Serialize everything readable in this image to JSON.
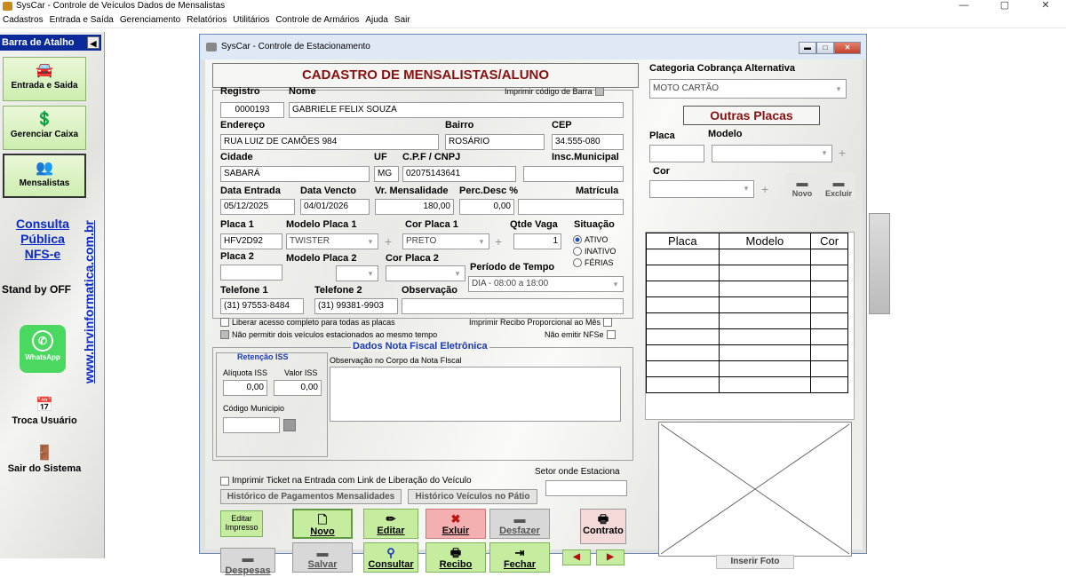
{
  "titlebar": {
    "title": "SysCar - Controle de Veículos  Dados de Mensalistas"
  },
  "winctl": {
    "min": "—",
    "max": "▢",
    "close": "✕"
  },
  "menu": [
    "Cadastros",
    "Entrada e Saída",
    "Gerenciamento",
    "Relatórios",
    "Utilitários",
    "Controle de Armários",
    "Ajuda",
    "Sair"
  ],
  "sidebar": {
    "header": "Barra de Atalho",
    "buttons": [
      {
        "label": "Entrada e Saida",
        "icon": "car-icon"
      },
      {
        "label": "Gerenciar Caixa",
        "icon": "money-icon"
      },
      {
        "label": "Mensalistas",
        "icon": "users-icon"
      }
    ],
    "nfse": "Consulta Pública NFS-e",
    "standby": "Stand by OFF",
    "whatsapp": "WhatsApp",
    "troca": "Troca Usuário",
    "sair": "Sair do Sistema",
    "url": "www.hrvinformatica.com.br"
  },
  "window": {
    "title": "SysCar - Controle de Estacionamento"
  },
  "form": {
    "heading": "CADASTRO DE MENSALISTAS/ALUNO",
    "labels": {
      "registro": "Registro",
      "nome": "Nome",
      "imprimir_codigo": "Imprimir código de Barra",
      "endereco": "Endereço",
      "bairro": "Bairro",
      "cep": "CEP",
      "cidade": "Cidade",
      "uf": "UF",
      "cpf": "C.P.F / CNPJ",
      "insc": "Insc.Municipal",
      "data_entrada": "Data Entrada",
      "data_vencto": "Data Vencto",
      "vr_mensalidade": "Vr. Mensalidade",
      "perc_desc": "Perc.Desc %",
      "matricula": "Matrícula",
      "placa1": "Placa 1",
      "modelo1": "Modelo Placa 1",
      "cor1": "Cor Placa 1",
      "qtde_vaga": "Qtde Vaga",
      "situacao": "Situação",
      "placa2": "Placa 2",
      "modelo2": "Modelo Placa 2",
      "cor2": "Cor Placa 2",
      "periodo": "Período de Tempo",
      "tel1": "Telefone 1",
      "tel2": "Telefone 2",
      "obs": "Observação"
    },
    "values": {
      "registro": "0000193",
      "nome": "GABRIELE FELIX SOUZA",
      "endereco": "RUA LUIZ DE CAMÕES 984",
      "bairro": "ROSÁRIO",
      "cep": "34.555-080",
      "cidade": "SABARÁ",
      "uf": "MG",
      "cpf": "02075143641",
      "insc": "",
      "data_entrada": "05/12/2025",
      "data_vencto": "04/01/2026",
      "vr_mensalidade": "180,00",
      "perc_desc": "0,00",
      "matricula": "",
      "placa1": "HFV2D92",
      "modelo1": "TWISTER",
      "cor1": "PRETO",
      "qtde_vaga": "1",
      "placa2": "",
      "modelo2": "",
      "cor2": "",
      "periodo": "DIA - 08:00 a 18:00",
      "tel1": "(31) 97553-8484",
      "tel2": "(31) 99381-9903",
      "obs": ""
    },
    "situacao_options": [
      {
        "label": "ATIVO",
        "selected": true
      },
      {
        "label": "INATIVO",
        "selected": false
      },
      {
        "label": "FÉRIAS",
        "selected": false
      }
    ],
    "checks": {
      "liberar": "Liberar acesso completo para todas as placas",
      "nao_permitir": "Não permitir dois veículos estacionados ao mesmo tempo",
      "imprimir_recibo": "Imprimir Recibo Proporcional ao Mês",
      "nao_emitir": "Não emitir NFSe"
    },
    "nfe": {
      "title": "Dados Nota Fiscal Eletrônica",
      "retencao": "Retenção ISS",
      "aliquota_lbl": "Alíquota ISS",
      "valor_lbl": "Valor ISS",
      "aliquota": "0,00",
      "valor": "0,00",
      "codigo_lbl": "Código Municipio",
      "obs_lbl": "Observação no Corpo da Nota FIscal"
    },
    "ticket": "Imprimir Ticket na Entrada com Link de Liberação do Veículo",
    "setor": "Setor onde Estaciona",
    "hist_pag": "Histórico de Pagamentos Mensalidades",
    "hist_veic": "Histórico Veículos no Pátio"
  },
  "buttons": {
    "editar_impresso": "Editar Impresso",
    "novo": "Novo",
    "editar": "Editar",
    "excluir": "Exluir",
    "desfazer": "Desfazer",
    "contrato": "Contrato",
    "despesas": "Despesas",
    "salvar": "Salvar",
    "consultar": "Consultar",
    "recibo": "Recibo",
    "fechar": "Fechar"
  },
  "right": {
    "categoria_lbl": "Categoria Cobrança Alternativa",
    "categoria": "MOTO CARTÃO",
    "outras_placas": "Outras Placas",
    "placa_lbl": "Placa",
    "modelo_lbl": "Modelo",
    "cor_lbl": "Cor",
    "novo": "Novo",
    "excluir": "Excluir",
    "table_headers": [
      "Placa",
      "Modelo",
      "Cor"
    ],
    "inserir_foto": "Inserir Foto"
  }
}
